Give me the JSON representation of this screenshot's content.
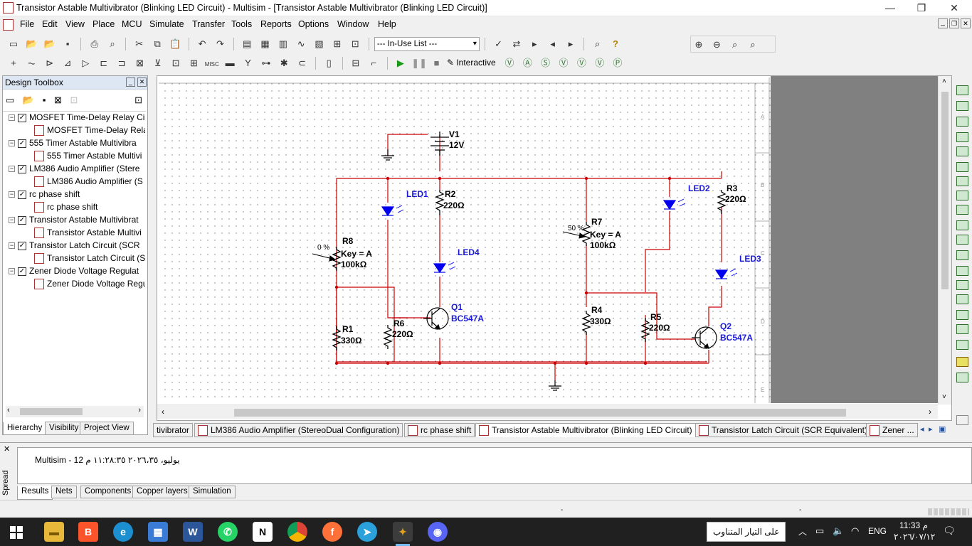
{
  "window": {
    "title": "Transistor Astable Multivibrator (Blinking LED Circuit) - Multisim - [Transistor Astable Multivibrator (Blinking LED Circuit)]",
    "controls": {
      "minimize": "—",
      "maximize": "❐",
      "close": "✕"
    },
    "mdi_controls": {
      "minimize": "_",
      "restore": "❐",
      "close": "✕"
    }
  },
  "menu": [
    "File",
    "Edit",
    "View",
    "Place",
    "MCU",
    "Simulate",
    "Transfer",
    "Tools",
    "Reports",
    "Options",
    "Window",
    "Help"
  ],
  "toolbar": {
    "in_use_list": "--- In-Use List ---",
    "interactive_label": "Interactive"
  },
  "design_toolbox": {
    "title": "Design Toolbox",
    "items": [
      {
        "label": "MOSFET Time-Delay Relay Ci",
        "child": "MOSFET Time-Delay Rela"
      },
      {
        "label": "555 Timer Astable Multivibra",
        "child": "555 Timer Astable Multivi"
      },
      {
        "label": "LM386 Audio Amplifier (Stere",
        "child": "LM386 Audio Amplifier (S"
      },
      {
        "label": "rc phase shift",
        "child": "rc phase shift"
      },
      {
        "label": "Transistor Astable Multivibrat",
        "child": "Transistor Astable Multivi"
      },
      {
        "label": "Transistor Latch Circuit (SCR",
        "child": "Transistor Latch Circuit (S"
      },
      {
        "label": "Zener Diode Voltage Regulat",
        "child": "Zener Diode Voltage Regu"
      }
    ],
    "tabs": [
      "Hierarchy",
      "Visibility",
      "Project View"
    ]
  },
  "schematic": {
    "border_letters": [
      "A",
      "B",
      "C",
      "D",
      "E"
    ],
    "labels": {
      "v1_name": "V1",
      "v1_value": "12V",
      "led1": "LED1",
      "led2": "LED2",
      "led3": "LED3",
      "led4": "LED4",
      "r1": "R1",
      "r1_value": "330Ω",
      "r2": "R2",
      "r2_value": "220Ω",
      "r3": "R3",
      "r3_value": "220Ω",
      "r4": "R4",
      "r4_value": "330Ω",
      "r5": "R5",
      "r5_value": "220Ω",
      "r6": "R6",
      "r6_value": "220Ω",
      "r7": "R7",
      "r7_key": "Key = A",
      "r7_value": "100kΩ",
      "r7_pct": "50 %",
      "r8": "R8",
      "r8_key": "Key = A",
      "r8_value": "100kΩ",
      "r8_pct": "0 %",
      "q1": "Q1",
      "q1_part": "BC547A",
      "q2": "Q2",
      "q2_part": "BC547A"
    },
    "colors": {
      "wire": "#cc0000",
      "component": "#000000",
      "led": "#0000ee",
      "led_label": "#1a1ad6"
    }
  },
  "sheet_tabs": [
    "tivibrator",
    "LM386 Audio Amplifier (StereoDual Configuration)",
    "rc phase shift",
    "Transistor Astable Multivibrator (Blinking LED Circuit)",
    "Transistor Latch Circuit (SCR Equivalent)",
    "Zener ..."
  ],
  "spreadsheet": {
    "side_label": "Spread",
    "message": "Multisim  -  يوليو، ٢٠٢٦،٣٥ ١١:٢٨:٣٥ م 12",
    "tabs": [
      "Results",
      "Nets",
      "Components",
      "Copper layers",
      "Simulation"
    ]
  },
  "statusbar": {
    "left": "-",
    "mid": "-"
  },
  "taskbar": {
    "tooltip": "على التيار المتناوب",
    "language": "ENG",
    "time": "11:33 م",
    "date": "٢٠٢٦/٠٧/١٢"
  }
}
